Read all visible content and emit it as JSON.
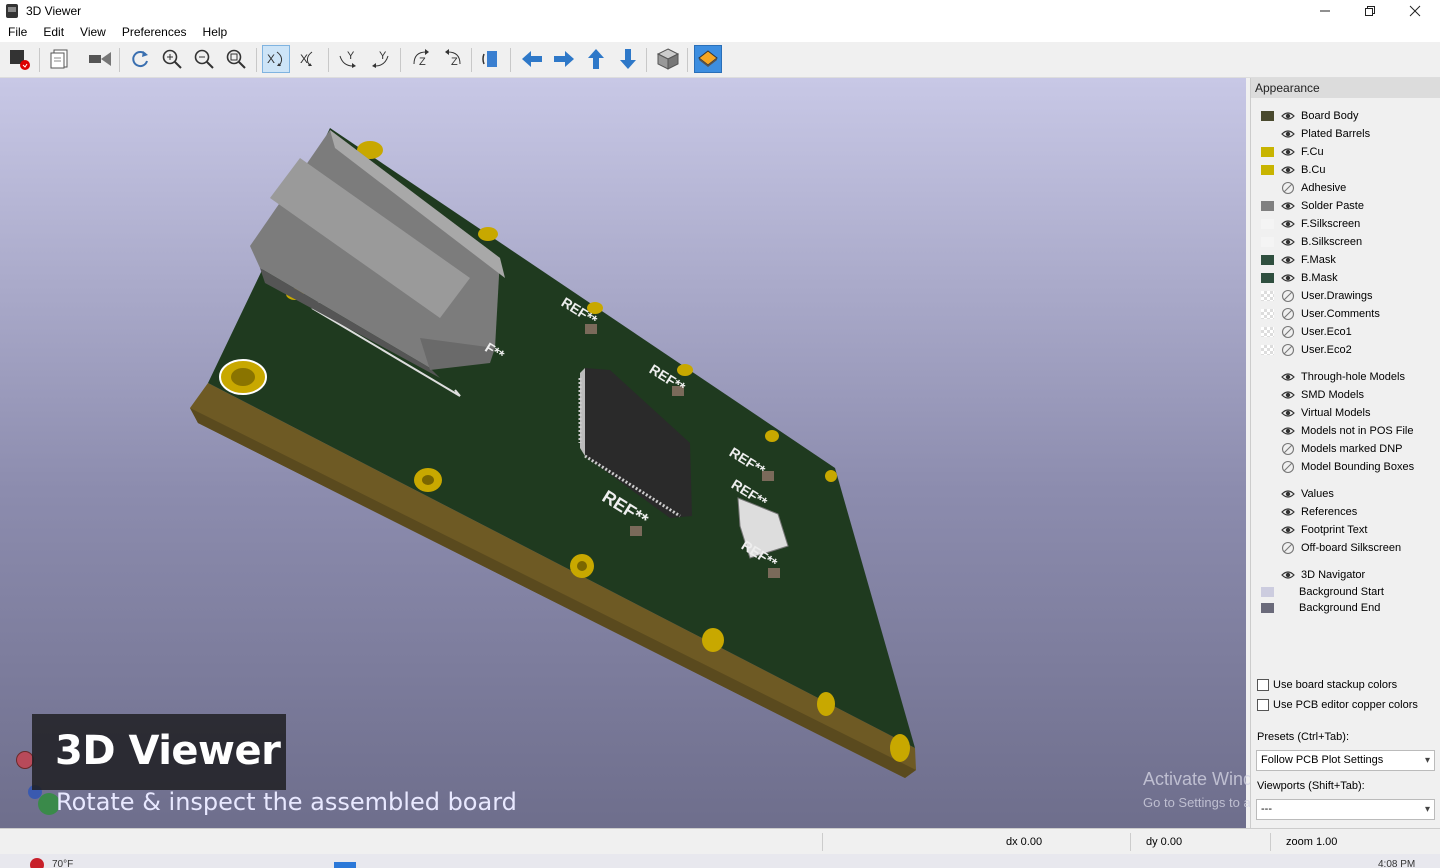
{
  "window": {
    "title": "3D Viewer"
  },
  "menu": [
    "File",
    "Edit",
    "View",
    "Preferences",
    "Help"
  ],
  "toolbar": {
    "icons": [
      "render-icon",
      "copy-image-icon",
      "raytrace-camera-icon",
      "reload-icon",
      "zoom-in-icon",
      "zoom-out-icon",
      "zoom-fit-icon",
      "rotate-x-cw-icon",
      "rotate-x-ccw-icon",
      "rotate-y-cw-icon",
      "rotate-y-ccw-icon",
      "rotate-z-cw-icon",
      "rotate-z-ccw-icon",
      "flip-board-icon",
      "move-left-icon",
      "move-right-icon",
      "move-up-icon",
      "move-down-icon",
      "orthographic-icon",
      "layers-manager-icon"
    ]
  },
  "appearance": {
    "header": "Appearance",
    "layers": [
      {
        "name": "Board Body",
        "color": "#4a4a2e",
        "visible": true
      },
      {
        "name": "Plated Barrels",
        "color": "",
        "visible": true
      },
      {
        "name": "F.Cu",
        "color": "#c8b400",
        "visible": true
      },
      {
        "name": "B.Cu",
        "color": "#c8b400",
        "visible": true
      },
      {
        "name": "Adhesive",
        "color": "",
        "visible": false
      },
      {
        "name": "Solder Paste",
        "color": "#808080",
        "visible": true
      },
      {
        "name": "F.Silkscreen",
        "color": "#f4f4f4",
        "visible": true
      },
      {
        "name": "B.Silkscreen",
        "color": "#f4f4f4",
        "visible": true
      },
      {
        "name": "F.Mask",
        "color": "#2f4f3f",
        "visible": true
      },
      {
        "name": "B.Mask",
        "color": "#2f4f3f",
        "visible": true
      },
      {
        "name": "User.Drawings",
        "color": "checker",
        "visible": false
      },
      {
        "name": "User.Comments",
        "color": "checker",
        "visible": false
      },
      {
        "name": "User.Eco1",
        "color": "checker",
        "visible": false
      },
      {
        "name": "User.Eco2",
        "color": "checker",
        "visible": false
      }
    ],
    "models": [
      {
        "name": "Through-hole Models",
        "visible": true
      },
      {
        "name": "SMD Models",
        "visible": true
      },
      {
        "name": "Virtual Models",
        "visible": true
      },
      {
        "name": "Models not in POS File",
        "visible": true
      },
      {
        "name": "Models marked DNP",
        "visible": false
      },
      {
        "name": "Model Bounding Boxes",
        "visible": false
      }
    ],
    "text": [
      {
        "name": "Values",
        "visible": true
      },
      {
        "name": "References",
        "visible": true
      },
      {
        "name": "Footprint Text",
        "visible": true
      },
      {
        "name": "Off-board Silkscreen",
        "visible": false
      }
    ],
    "misc": [
      {
        "name": "3D Navigator",
        "visible": true
      }
    ],
    "background": [
      {
        "name": "Background Start",
        "color": "#ccccdf"
      },
      {
        "name": "Background End",
        "color": "#6a6a7a"
      }
    ],
    "use_board_stackup_colors": "Use board stackup colors",
    "use_pcb_copper_colors": "Use PCB editor copper colors",
    "presets_label": "Presets (Ctrl+Tab):",
    "presets_value": "Follow PCB Plot Settings",
    "viewports_label": "Viewports (Shift+Tab):",
    "viewports_value": "---"
  },
  "status": {
    "dx": "dx 0.00",
    "dy": "dy 0.00",
    "zoom": "zoom 1.00"
  },
  "overlay": {
    "title": "3D Viewer",
    "subtitle": "Rotate & inspect the assembled board"
  },
  "watermark": {
    "line1": "Activate Windows",
    "line2": "Go to Settings to activate Windows."
  },
  "board": {
    "ref_label": "REF**",
    "fp_label": "F**"
  },
  "taskbar": {
    "temp": "70°F",
    "time": "4:08 PM"
  }
}
